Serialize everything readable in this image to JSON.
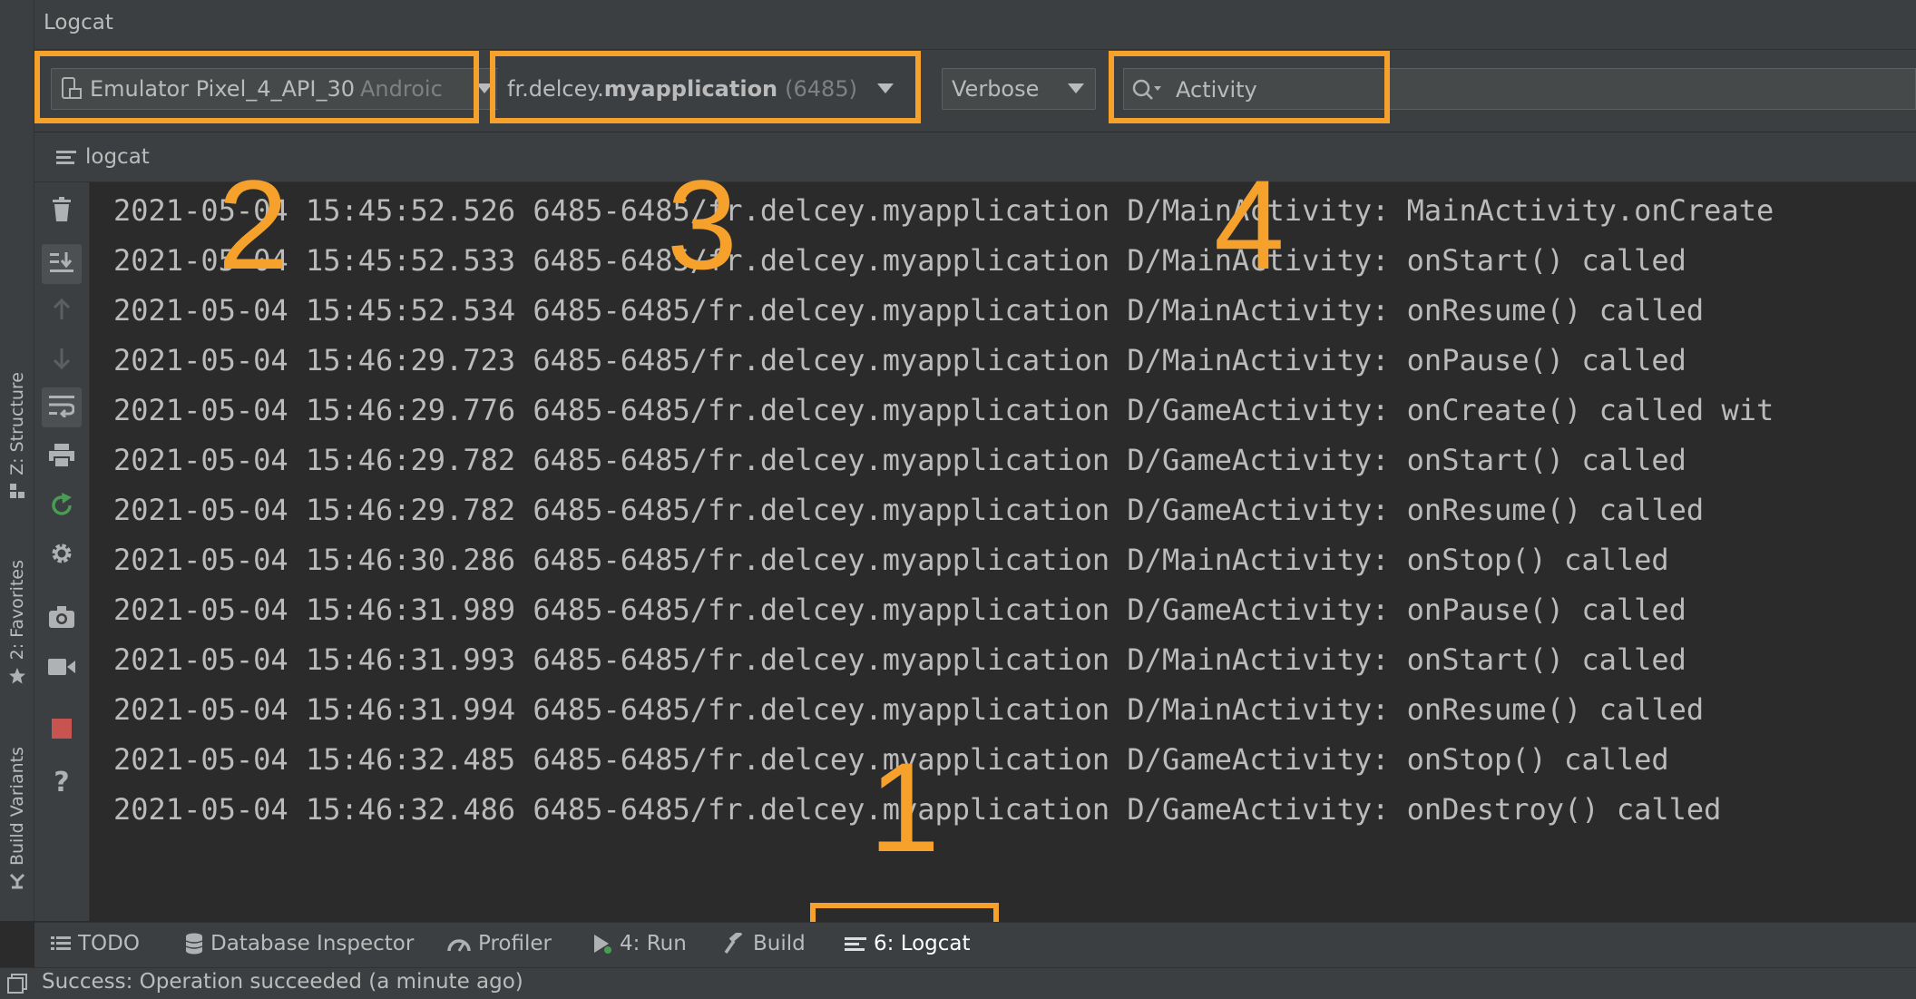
{
  "header": {
    "title": "Logcat"
  },
  "toolbar": {
    "device": {
      "name": "Emulator Pixel_4_API_30",
      "suffix": "Androic"
    },
    "process": {
      "package_plain": "fr.delcey.",
      "package_bold": "myapplication",
      "pid": "(6485)"
    },
    "level": "Verbose",
    "search": {
      "value": "Activity"
    }
  },
  "tab": {
    "label": "logcat"
  },
  "log_lines": [
    {
      "date": "2021-05-04",
      "time": "15:45:52.526",
      "pid": "6485-6485",
      "pkg": "fr.delcey.myapplication",
      "tag": "D/MainActivity:",
      "msg": "MainActivity.onCreate"
    },
    {
      "date": "2021-05-04",
      "time": "15:45:52.533",
      "pid": "6485-6485",
      "pkg": "fr.delcey.myapplication",
      "tag": "D/MainActivity:",
      "msg": "onStart() called"
    },
    {
      "date": "2021-05-04",
      "time": "15:45:52.534",
      "pid": "6485-6485",
      "pkg": "fr.delcey.myapplication",
      "tag": "D/MainActivity:",
      "msg": "onResume() called"
    },
    {
      "date": "2021-05-04",
      "time": "15:46:29.723",
      "pid": "6485-6485",
      "pkg": "fr.delcey.myapplication",
      "tag": "D/MainActivity:",
      "msg": "onPause() called"
    },
    {
      "date": "2021-05-04",
      "time": "15:46:29.776",
      "pid": "6485-6485",
      "pkg": "fr.delcey.myapplication",
      "tag": "D/GameActivity:",
      "msg": "onCreate() called wit"
    },
    {
      "date": "2021-05-04",
      "time": "15:46:29.782",
      "pid": "6485-6485",
      "pkg": "fr.delcey.myapplication",
      "tag": "D/GameActivity:",
      "msg": "onStart() called"
    },
    {
      "date": "2021-05-04",
      "time": "15:46:29.782",
      "pid": "6485-6485",
      "pkg": "fr.delcey.myapplication",
      "tag": "D/GameActivity:",
      "msg": "onResume() called"
    },
    {
      "date": "2021-05-04",
      "time": "15:46:30.286",
      "pid": "6485-6485",
      "pkg": "fr.delcey.myapplication",
      "tag": "D/MainActivity:",
      "msg": "onStop() called"
    },
    {
      "date": "2021-05-04",
      "time": "15:46:31.989",
      "pid": "6485-6485",
      "pkg": "fr.delcey.myapplication",
      "tag": "D/GameActivity:",
      "msg": "onPause() called"
    },
    {
      "date": "2021-05-04",
      "time": "15:46:31.993",
      "pid": "6485-6485",
      "pkg": "fr.delcey.myapplication",
      "tag": "D/MainActivity:",
      "msg": "onStart() called"
    },
    {
      "date": "2021-05-04",
      "time": "15:46:31.994",
      "pid": "6485-6485",
      "pkg": "fr.delcey.myapplication",
      "tag": "D/MainActivity:",
      "msg": "onResume() called"
    },
    {
      "date": "2021-05-04",
      "time": "15:46:32.485",
      "pid": "6485-6485",
      "pkg": "fr.delcey.myapplication",
      "tag": "D/GameActivity:",
      "msg": "onStop() called"
    },
    {
      "date": "2021-05-04",
      "time": "15:46:32.486",
      "pid": "6485-6485",
      "pkg": "fr.delcey.myapplication",
      "tag": "D/GameActivity:",
      "msg": "onDestroy() called"
    }
  ],
  "annotations": {
    "n1": "1",
    "n2": "2",
    "n3": "3",
    "n4": "4"
  },
  "side_tabs": {
    "structure": "Z: Structure",
    "favorites": "2: Favorites",
    "build_variants": "Build Variants"
  },
  "bottom_tabs": {
    "todo": "TODO",
    "database": "Database Inspector",
    "profiler": "Profiler",
    "run": "4: Run",
    "build": "Build",
    "logcat": "6: Logcat"
  },
  "status": {
    "text": "Success: Operation succeeded (a minute ago)"
  },
  "colors": {
    "highlight": "#f5a12c",
    "background": "#2b2b2b",
    "panel": "#3c3f41",
    "stop": "#c75450",
    "rerun": "#499c54"
  }
}
